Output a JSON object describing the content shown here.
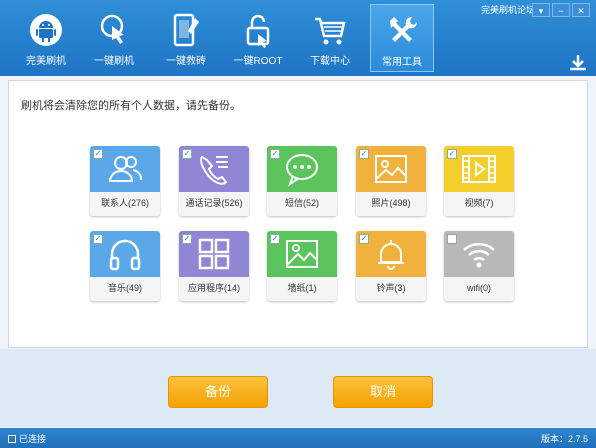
{
  "header": {
    "forum_link": "完美刷机论坛",
    "tabs": [
      {
        "label": "完美刷机",
        "icon": "android-robot-icon"
      },
      {
        "label": "一键刷机",
        "icon": "hand-tap-icon"
      },
      {
        "label": "一键救砖",
        "icon": "phone-wrench-icon"
      },
      {
        "label": "一键ROOT",
        "icon": "unlock-icon"
      },
      {
        "label": "下载中心",
        "icon": "shopping-cart-icon"
      },
      {
        "label": "常用工具",
        "icon": "tools-icon"
      }
    ],
    "active_tab": "常用工具"
  },
  "main": {
    "notice": "刷机将会清除您的所有个人数据，请先备份。",
    "tiles": [
      {
        "label": "联系人(276)",
        "icon": "contacts-icon",
        "color": "#5aa8e8",
        "checked": true
      },
      {
        "label": "通话记录(526)",
        "icon": "phone-call-log-icon",
        "color": "#8f86d6",
        "checked": true
      },
      {
        "label": "短信(52)",
        "icon": "sms-bubble-icon",
        "color": "#5cc45c",
        "checked": true
      },
      {
        "label": "照片(498)",
        "icon": "photo-icon",
        "color": "#f0b23c",
        "checked": true
      },
      {
        "label": "视频(7)",
        "icon": "video-icon",
        "color": "#f2cf2a",
        "checked": true
      },
      {
        "label": "音乐(49)",
        "icon": "headphones-icon",
        "color": "#5aa8e8",
        "checked": true
      },
      {
        "label": "应用程序(14)",
        "icon": "apps-grid-icon",
        "color": "#8f86d6",
        "checked": true
      },
      {
        "label": "墙纸(1)",
        "icon": "wallpaper-icon",
        "color": "#5cc45c",
        "checked": true
      },
      {
        "label": "铃声(3)",
        "icon": "bell-icon",
        "color": "#f0b23c",
        "checked": true
      },
      {
        "label": "wifi(0)",
        "icon": "wifi-icon",
        "color": "#b8b8b8",
        "checked": false
      }
    ]
  },
  "actions": {
    "backup_label": "备份",
    "cancel_label": "取消"
  },
  "status": {
    "connection": "已连接",
    "version": "版本：2.7.5"
  }
}
